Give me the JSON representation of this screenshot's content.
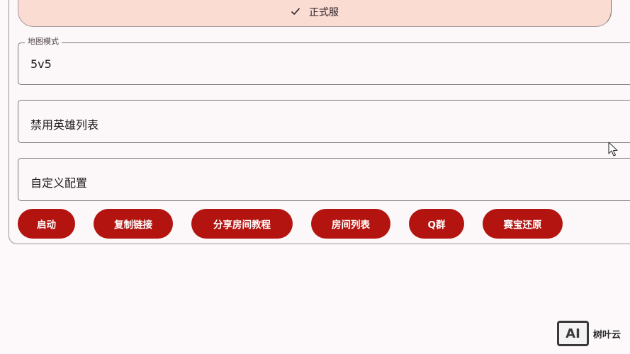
{
  "version_bar": {
    "label": "正式服",
    "icon": "check-icon"
  },
  "fields": {
    "map_mode": {
      "legend": "地图模式",
      "value": "5v5"
    },
    "ban_list": {
      "value": "禁用英雄列表"
    },
    "custom_config": {
      "value": "自定义配置"
    }
  },
  "buttons": {
    "start": "启动",
    "copy_link": "复制链接",
    "share_tutorial": "分享房间教程",
    "room_list": "房间列表",
    "q_group": "Q群",
    "restore": "赛宝还原"
  },
  "watermark": {
    "logo": "AI",
    "text": "树叶云"
  },
  "colors": {
    "accent": "#b3140f",
    "version_bg": "#fbdcd3",
    "page_bg": "#fdf8fa"
  }
}
